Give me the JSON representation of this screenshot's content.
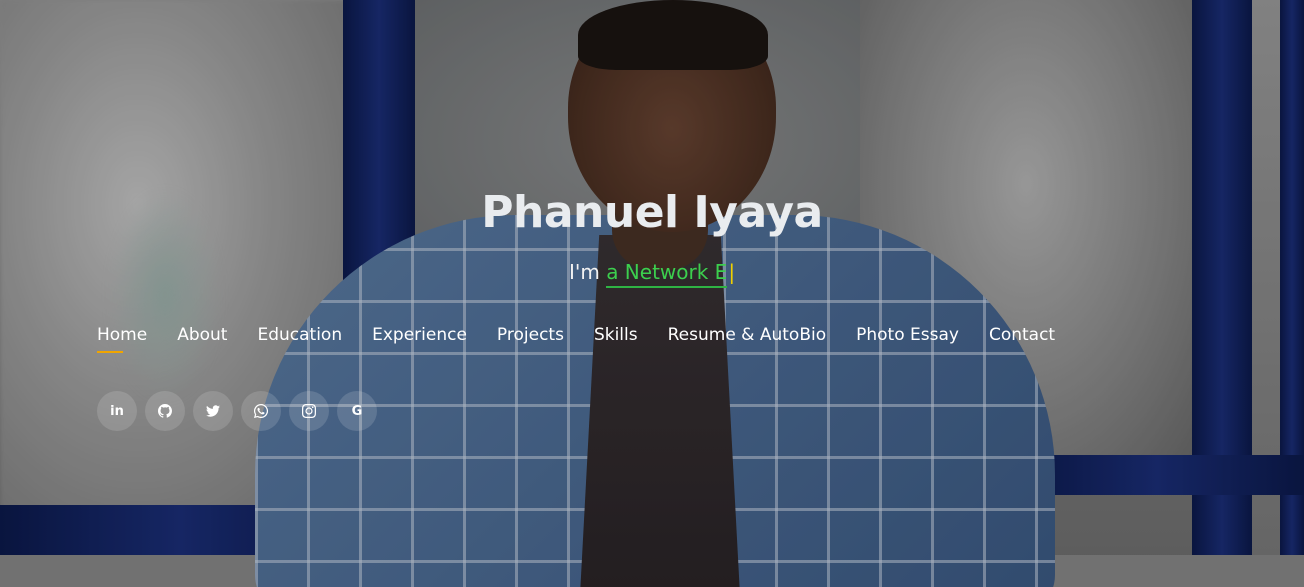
{
  "profile": {
    "name": "Phanuel Iyaya",
    "typed_prefix": "I'm",
    "typed_text": "a Network E",
    "typed_cursor": "|"
  },
  "nav": {
    "items": [
      {
        "label": "Home",
        "active": true
      },
      {
        "label": "About",
        "active": false
      },
      {
        "label": "Education",
        "active": false
      },
      {
        "label": "Experience",
        "active": false
      },
      {
        "label": "Projects",
        "active": false
      },
      {
        "label": "Skills",
        "active": false
      },
      {
        "label": "Resume & AutoBio",
        "active": false
      },
      {
        "label": "Photo Essay",
        "active": false
      },
      {
        "label": "Contact",
        "active": false
      }
    ]
  },
  "social": [
    {
      "icon": "linkedin-icon",
      "glyph": "in"
    },
    {
      "icon": "github-icon",
      "glyph": ""
    },
    {
      "icon": "twitter-icon",
      "glyph": ""
    },
    {
      "icon": "whatsapp-icon",
      "glyph": ""
    },
    {
      "icon": "instagram-icon",
      "glyph": ""
    },
    {
      "icon": "google-icon",
      "glyph": "G"
    }
  ],
  "colors": {
    "typed_green": "#3ccf4e",
    "active_underline": "#f0a500",
    "cursor_yellow": "#f0d000"
  }
}
